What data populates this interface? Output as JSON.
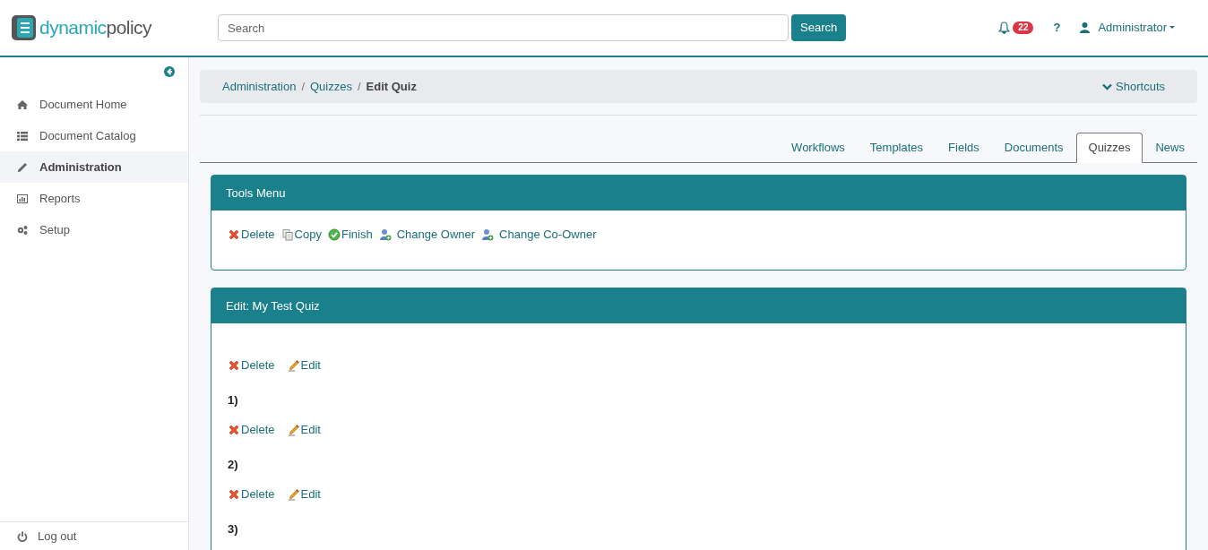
{
  "logo": {
    "part_a": "dynamic",
    "part_b": "policy"
  },
  "search": {
    "placeholder": "Search",
    "button": "Search"
  },
  "header": {
    "notifications": "22",
    "help": "?",
    "user": "Administrator"
  },
  "sidebar": {
    "items": [
      {
        "kind": "home",
        "label": "Document Home",
        "selected": false
      },
      {
        "kind": "list",
        "label": "Document Catalog",
        "selected": false
      },
      {
        "kind": "pencil",
        "label": "Administration",
        "selected": true
      },
      {
        "kind": "chart",
        "label": "Reports",
        "selected": false
      },
      {
        "kind": "gears",
        "label": "Setup",
        "selected": false
      }
    ],
    "logout": "Log out"
  },
  "breadcrumb": [
    {
      "label": "Administration"
    },
    {
      "separator": "/",
      "label": "Quizzes"
    },
    {
      "separator": "/",
      "label": "Edit Quiz"
    }
  ],
  "shortcuts": "Shortcuts",
  "tabs": [
    {
      "label": "Workflows",
      "selected": false
    },
    {
      "label": "Templates",
      "selected": false
    },
    {
      "label": "Fields",
      "selected": false
    },
    {
      "label": "Documents",
      "selected": false
    },
    {
      "label": "Quizzes",
      "selected": true
    },
    {
      "label": "News",
      "selected": false
    }
  ],
  "tools_panel": {
    "title": "Tools Menu",
    "actions": [
      {
        "kind": "delete",
        "label": "Delete"
      },
      {
        "kind": "copy",
        "label": "Copy"
      },
      {
        "kind": "finish",
        "label": "Finish"
      },
      {
        "kind": "owner",
        "label": "Change Owner"
      },
      {
        "kind": "owner",
        "label": "Change Co-Owner"
      }
    ]
  },
  "edit_panel": {
    "title": "Edit: My Test Quiz",
    "actions": [
      {
        "kind": "delete",
        "label": "Delete"
      },
      {
        "kind": "edit",
        "label": "Edit"
      }
    ],
    "questions": [
      {
        "label": "1)",
        "actions": [
          {
            "kind": "delete",
            "label": "Delete"
          },
          {
            "kind": "edit",
            "label": "Edit"
          }
        ]
      },
      {
        "label": "2)",
        "actions": [
          {
            "kind": "delete",
            "label": "Delete"
          },
          {
            "kind": "edit",
            "label": "Edit"
          }
        ]
      },
      {
        "label": "3)"
      }
    ]
  }
}
